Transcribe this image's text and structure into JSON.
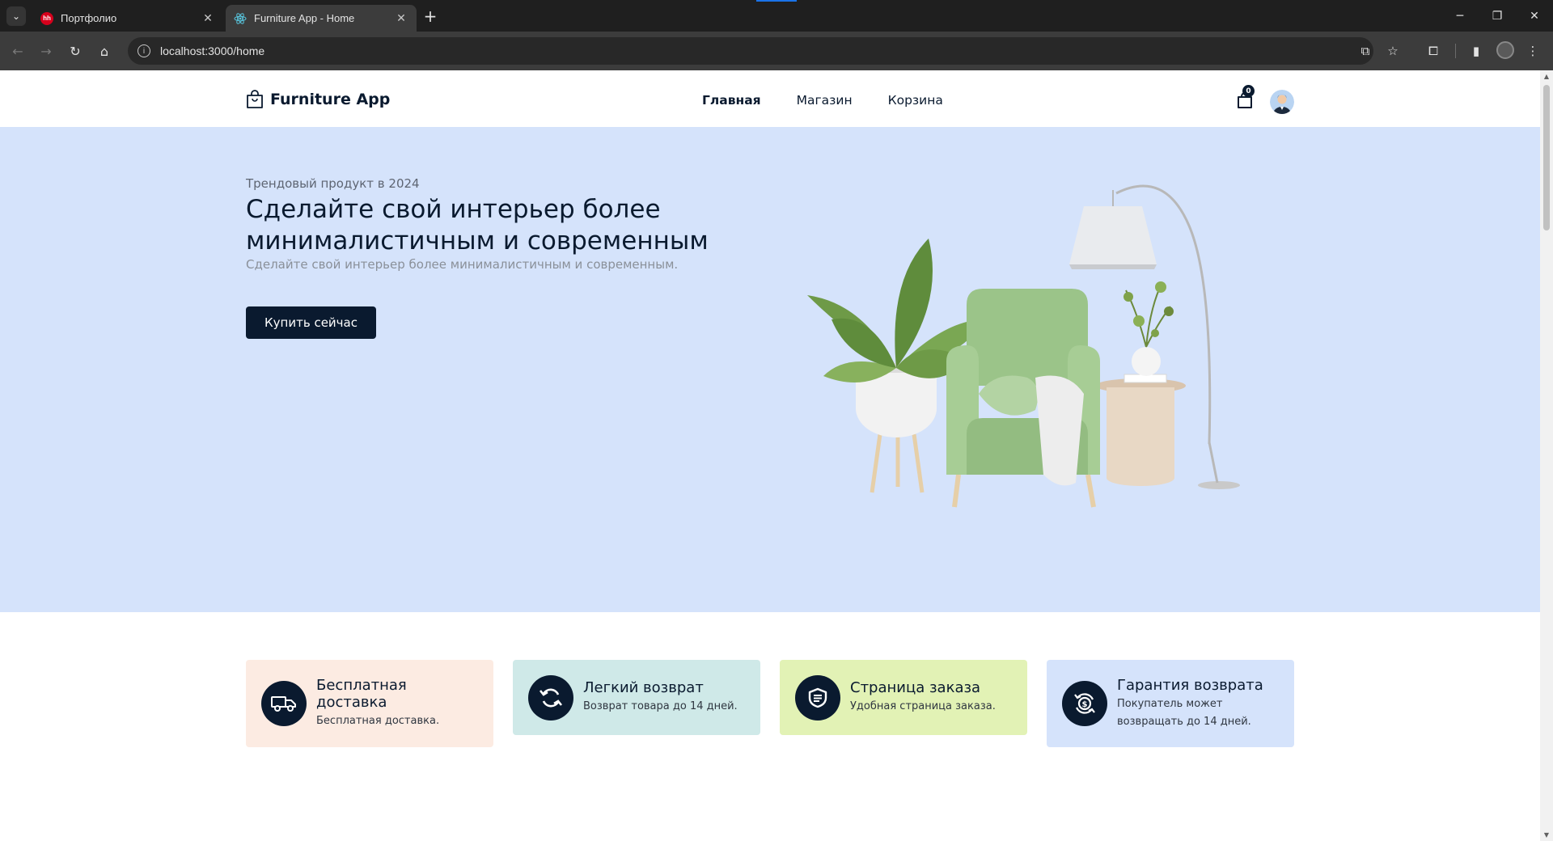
{
  "browser": {
    "tabs": [
      {
        "favicon": "hh",
        "title": "Портфолио"
      },
      {
        "favicon": "react-icon",
        "title": "Furniture App - Home"
      }
    ],
    "url": "localhost:3000/home"
  },
  "site": {
    "brand": "Furniture App",
    "nav": [
      "Главная",
      "Магазин",
      "Корзина"
    ],
    "active_nav": "Главная",
    "cart_count": "0"
  },
  "hero": {
    "kicker": "Трендовый продукт в 2024",
    "title": "Сделайте свой интерьер более минималистичным и современным",
    "subtitle": "Сделайте свой интерьер более минималистичным и современным.",
    "cta": "Купить сейчас"
  },
  "features": [
    {
      "icon": "truck-icon",
      "title": "Бесплатная доставка",
      "desc": "Бесплатная доставка.",
      "bg": "#fcebe2"
    },
    {
      "icon": "refresh-icon",
      "title": "Легкий возврат",
      "desc": "Возврат товара до 14 дней.",
      "bg": "#cfe9e8"
    },
    {
      "icon": "shield-icon",
      "title": "Страница заказа",
      "desc": "Удобная страница заказа.",
      "bg": "#e2f2b5"
    },
    {
      "icon": "money-back-icon",
      "title": "Гарантия возврата",
      "desc": "Покупатель может возвращать до 14 дней.",
      "bg": "#d5e3fb"
    }
  ],
  "colors": {
    "primary": "#0a1a2f",
    "hero_bg": "#d5e3fb"
  }
}
